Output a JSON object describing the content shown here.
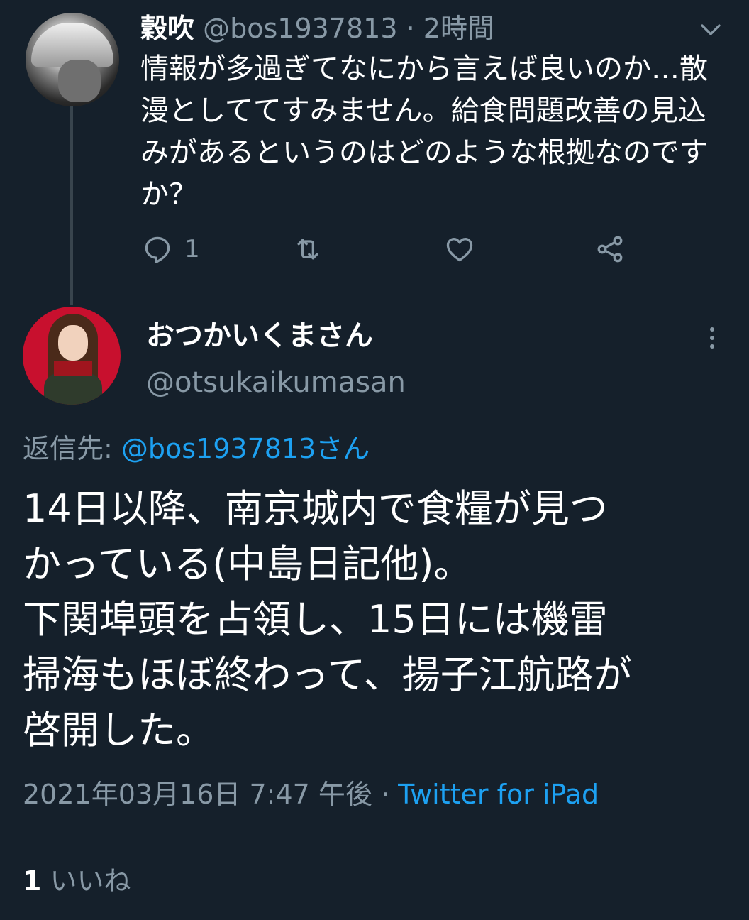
{
  "parent_tweet": {
    "display_name": "穀吹",
    "handle": "@bos1937813",
    "time": "· 2時間",
    "text": "情報が多過ぎてなにから言えば良いのか…散漫としててすみません。給食問題改善の見込みがあるというのはどのような根拠なのですか？",
    "reply_count": "1",
    "icons": {
      "reply": "reply-icon",
      "retweet": "retweet-icon",
      "like": "like-icon",
      "share": "share-icon",
      "menu": "chevron-down-icon"
    }
  },
  "main_tweet": {
    "display_name": "おつかいくまさん",
    "handle": "@otsukaikumasan",
    "reply_to_label": "返信先: ",
    "reply_to_user": "@bos1937813さん",
    "text_lines": [
      "14日以降、南京城内で食糧が見つ",
      "かっている(中島日記他)。",
      "下関埠頭を占領し、15日には機雷",
      "掃海もほぼ終わって、揚子江航路が",
      "啓開した。"
    ],
    "timestamp": "2021年03月16日 7:47 午後 · ",
    "source": "Twitter for iPad",
    "likes_count": "1",
    "likes_label": " いいね",
    "icons": {
      "menu": "more-vertical-icon"
    }
  },
  "colors": {
    "background": "#15202b",
    "link": "#1da1f2",
    "secondary_text": "#8899a6",
    "divider": "#38444d"
  }
}
